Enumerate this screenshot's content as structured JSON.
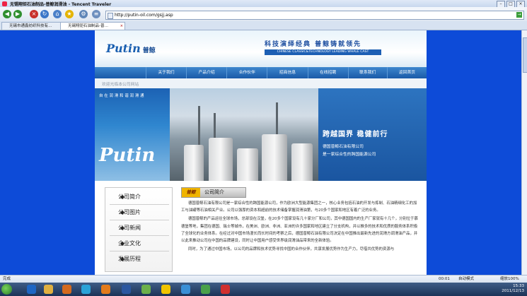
{
  "window": {
    "title": "无锡翔钜石油制品-普鲸润滑油 - Tencent Traveler"
  },
  "address": {
    "url": "http://putin-oil.com/gsjj.asp"
  },
  "tabs": [
    {
      "label": "无锡市通鑫纺织科技有…"
    },
    {
      "label": "无锡翔钜石油制品-普…"
    }
  ],
  "site": {
    "logo": "Putin",
    "logo_cn": "普鲸",
    "slogan": "科技演绎经典  普鲸铸就领先",
    "slogan_en": "CHINESE CLASSIC&TECHNOLOGY LEADING WHALE CAST",
    "nav": [
      "关于我们",
      "产品介绍",
      "合作伙伴",
      "招商信息",
      "在线招聘",
      "联系我们",
      "返回首页"
    ],
    "crumb": "欢迎光临本公司网站",
    "hero_tag": "自 在 润 滑  和 谐 润 滑 通",
    "hero_logo": "Putin",
    "hero_slogan": "跨越国界  稳健前行",
    "hero_sub1": "德国普鲸石油有限公司",
    "hero_sub2": "是一家综合性的跨国能源公司",
    "menu": [
      "公司简介",
      "公司图片",
      "公司新闻",
      "企业文化",
      "发展历程"
    ],
    "section_badge": "普鲸",
    "section_title": "公司简介",
    "paragraphs": [
      "德国普鲸石油有限公司是一家综合性的跨国能源公司，作为欧洲大型能源集团之一，核心业务包括石油的开发与炼制、石油精细化工的加工与油罐等石油相关产业。公司以强厚的资本和超前的技术储备掌握润滑油第，与20多个国家和地区有着广泛的业务。",
      "德国普鲸的产品运往全球市场，总部设在汉堡，在20多个国家设有几十家分厂和公司，其中德国国内的生产厂家就有十几个，分别位于慕德堡等地，集团在德国、瑞士等城市，在美洲、欧洲、非洲、亚洲的许多国家和地区建立了分支机构，并以推多的技术和优质的服务体系积极了全球化的业务体系。在经过对中国市场漫长而长时间的考察之后，德国普鲸石油有限公司决定在中国推出最新先进的润滑方调滑油产品，并以此来推动公司在中国的品牌建设，同时让中国用户感受世界级润滑油品带来的全新体验。",
      "同时，为了通过中国市场，以公司的品牌和技术优势寻找中国的合作伙伴，共谋发展优势作为生产力，尽借共优势的资源与"
    ]
  },
  "status": {
    "left": "完成",
    "zoom": "缩放100%",
    "mode": "自动模式",
    "page": "00:01"
  },
  "tray": {
    "time": "15:33",
    "date": "2011/12/13"
  }
}
